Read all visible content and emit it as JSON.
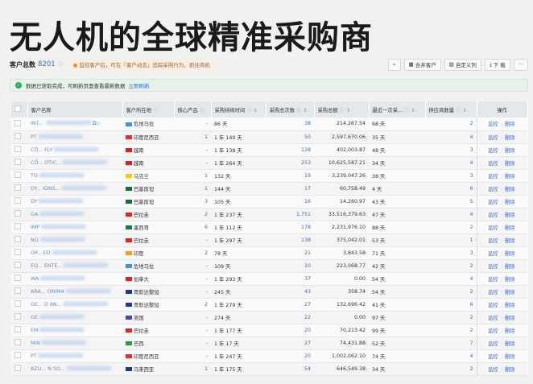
{
  "title": "无人机的全球精准采购商",
  "summary": {
    "label": "客户总数",
    "count": "8201",
    "tip": "监控客户后，可在「客户动态」追踪采购行为，抓住商机"
  },
  "toolbar": {
    "merge": "合并客户",
    "custom_cols": "自定义列",
    "download": "下 载",
    "more": "···"
  },
  "notice": {
    "text": "数据已获取完成，可刷新页面查看最新数据",
    "link": "立即刷新"
  },
  "columns": [
    "客户名称",
    "客户所在地",
    "核心产品",
    "采购持续时间",
    "采购总次数",
    "采购总额",
    "最近一次采...",
    "供应商数量",
    "操作"
  ],
  "actions": {
    "monitor": "监控",
    "delete": "删除"
  },
  "flag_colors": {
    "危地马拉": "#4a90d9",
    "印度尼西亚": "#e03030",
    "越南": "#d82020",
    "乌克兰": "#f5c518",
    "巴基斯坦": "#1b6b35",
    "巴拉圭": "#d52b1e",
    "墨西哥": "#1a7a3a",
    "印度": "#f39c34",
    "加拿大": "#e02020",
    "哥斯达黎加": "#1e3b8a",
    "美国": "#3c4f9b",
    "巴西": "#2a9a3a",
    "马来西亚": "#1e3b8a"
  },
  "rows": [
    {
      "name": "INT... ",
      "loc": "危地马拉",
      "core": "-",
      "dur": "86 天",
      "times": "38",
      "amount": "214,267.54",
      "last": "68 天",
      "sup": "2"
    },
    {
      "name": "PT",
      "loc": "印度尼西亚",
      "core": "1",
      "dur": "1 年 140 天",
      "times": "50",
      "amount": "2,597,670.06",
      "last": "35 天",
      "sup": "4"
    },
    {
      "name": "CÔ... FLY",
      "loc": "越南",
      "core": "-",
      "dur": "1 年 138 天",
      "times": "128",
      "amount": "402,003.87",
      "last": "48 天",
      "sup": "3"
    },
    {
      "name": "CÔ... OTIC...",
      "loc": "越南",
      "core": "-",
      "dur": "1 年 264 天",
      "times": "253",
      "amount": "10,625,587.21",
      "last": "34 天",
      "sup": "4"
    },
    {
      "name": "TO",
      "loc": "乌克兰",
      "core": "1",
      "dur": "132 天",
      "times": "19",
      "amount": "3,239,047.26",
      "last": "38 天",
      "sup": "3"
    },
    {
      "name": "DY... IONS...",
      "loc": "巴基斯坦",
      "core": "1",
      "dur": "144 天",
      "times": "17",
      "amount": "60,758.49",
      "last": "4 天",
      "sup": "6"
    },
    {
      "name": "DY",
      "loc": "巴基斯坦",
      "core": "3",
      "dur": "105 天",
      "times": "16",
      "amount": "14,260.97",
      "last": "43 天",
      "sup": "5"
    },
    {
      "name": "GA",
      "loc": "巴拉圭",
      "core": "2",
      "dur": "1 年 237 天",
      "times": "1,751",
      "amount": "33,516,379.63",
      "last": "47 天",
      "sup": "4"
    },
    {
      "name": "IMP",
      "loc": "墨西哥",
      "core": "6",
      "dur": "1 年 112 天",
      "times": "178",
      "amount": "2,231,976.10",
      "last": "88 天",
      "sup": "2"
    },
    {
      "name": "NG",
      "loc": "巴拉圭",
      "core": "-",
      "dur": "1 年 297 天",
      "times": "138",
      "amount": "375,042.01",
      "last": "53 天",
      "sup": "1"
    },
    {
      "name": "OP... ED",
      "loc": "印度",
      "core": "2",
      "dur": "78 天",
      "times": "21",
      "amount": "3,843.58",
      "last": "71 天",
      "sup": "3"
    },
    {
      "name": "EQ... ENTE...",
      "loc": "危地马拉",
      "core": "-",
      "dur": "109 天",
      "times": "10",
      "amount": "223,068.77",
      "last": "42 天",
      "sup": "2"
    },
    {
      "name": "WA",
      "loc": "加拿大",
      "core": "-",
      "dur": "1 年 293 天",
      "times": "37",
      "amount": "0.00",
      "last": "54 天",
      "sup": "4"
    },
    {
      "name": "ARA... ONIMA",
      "loc": "哥斯达黎加",
      "core": "-",
      "dur": "245 天",
      "times": "43",
      "amount": "358.74",
      "last": "54 天",
      "sup": "2"
    },
    {
      "name": "GE... D AN...",
      "loc": "哥斯达黎加",
      "core": "2",
      "dur": "1 年 279 天",
      "times": "27",
      "amount": "132,696.42",
      "last": "41 天",
      "sup": "6"
    },
    {
      "name": "GE",
      "loc": "美国",
      "core": "-",
      "dur": "274 天",
      "times": "22",
      "amount": "0.00",
      "last": "97 天",
      "sup": "2"
    },
    {
      "name": "EM",
      "loc": "巴拉圭",
      "core": "-",
      "dur": "1 年 177 天",
      "times": "20",
      "amount": "70,213.42",
      "last": "99 天",
      "sup": "2"
    },
    {
      "name": "MIN",
      "loc": "巴西",
      "core": "-",
      "dur": "1 年 17 天",
      "times": "27",
      "amount": "74,431.88",
      "last": "52 天",
      "sup": "7"
    },
    {
      "name": "PT",
      "loc": "印度尼西亚",
      "core": "-",
      "dur": "1 年 247 天",
      "times": "20",
      "amount": "1,002,062.10",
      "last": "74 天",
      "sup": "4"
    },
    {
      "name": "AZU... N SO...",
      "loc": "马来西亚",
      "core": "1",
      "dur": "1 年 175 天",
      "times": "54",
      "amount": "646,549.38",
      "last": "34 天",
      "sup": "2"
    }
  ]
}
